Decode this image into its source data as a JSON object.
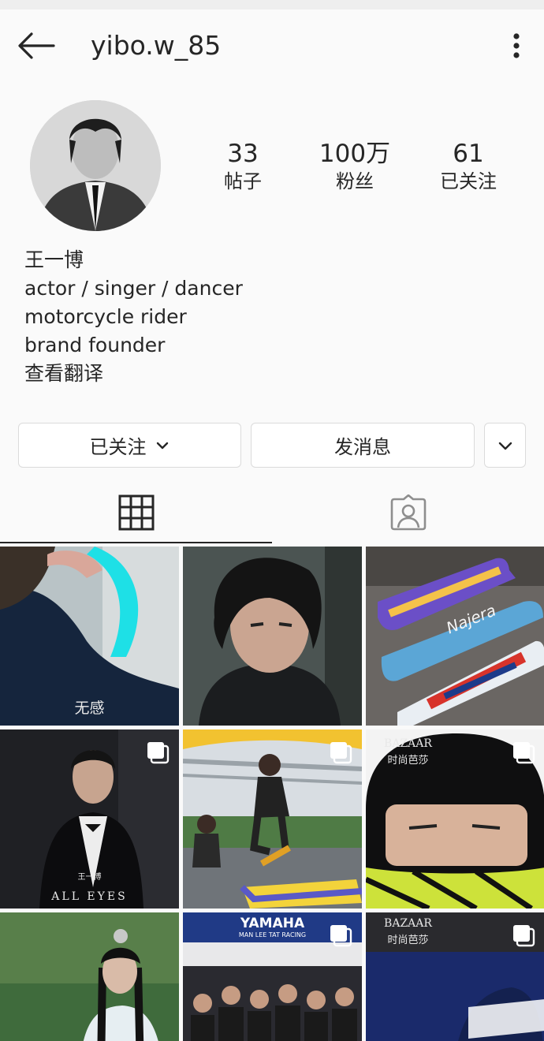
{
  "header": {
    "username": "yibo.w_85",
    "back_icon": "back-arrow-icon",
    "more_icon": "more-vertical-icon"
  },
  "profile": {
    "stats": [
      {
        "value": "33",
        "label": "帖子"
      },
      {
        "value": "100万",
        "label": "粉丝"
      },
      {
        "value": "61",
        "label": "已关注"
      }
    ],
    "bio": {
      "name": "王一博",
      "lines": [
        "actor / singer / dancer",
        "motorcycle rider",
        "brand founder"
      ],
      "translate_link": "查看翻译"
    }
  },
  "actions": {
    "following_label": "已关注",
    "message_label": "发消息",
    "suggest_icon": "chevron-down-icon"
  },
  "tabs": [
    {
      "icon": "grid-icon",
      "active": true
    },
    {
      "icon": "tagged-person-icon",
      "active": false
    }
  ],
  "posts": [
    {
      "caption": "无感",
      "multi": false
    },
    {
      "caption": "",
      "multi": false
    },
    {
      "caption": "Najera",
      "multi": false
    },
    {
      "caption": "ALL EYES",
      "caption_top": "王一博",
      "multi": true
    },
    {
      "caption": "",
      "multi": true
    },
    {
      "caption": "BAZAAR",
      "caption_sub": "时尚芭莎",
      "multi": true
    },
    {
      "caption": "",
      "multi": false
    },
    {
      "caption": "YAMAHA",
      "caption_sub": "MAN LEE TAT RACING",
      "multi": true
    },
    {
      "caption": "BAZAAR",
      "caption_sub": "时尚芭莎",
      "multi": true
    }
  ],
  "colors": {
    "background": "#fafafa",
    "text": "#262626",
    "border": "#dbdbdb"
  }
}
